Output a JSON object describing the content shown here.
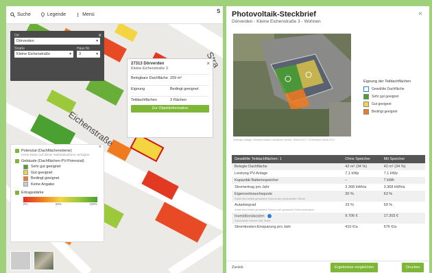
{
  "topbar": {
    "search_label": "Suche",
    "legend_label": "Legende",
    "menu_label": "Menü",
    "right_letter": "S"
  },
  "search_panel": {
    "ort_label": "Ort",
    "ort_value": "Dörverden",
    "strasse_label": "Straße",
    "strasse_value": "Kleine Eichenstraße",
    "hausnr_label": "Haus Nr.",
    "hausnr_value": "3"
  },
  "map": {
    "street_name": "Eichenstraße",
    "street_fragment": "Stra"
  },
  "popup": {
    "title": "27313 Dörverden",
    "subtitle": "Kleine Eichenstraße 3",
    "rows": [
      {
        "k": "Belegbare Dachfläche",
        "v": "209 m²"
      },
      {
        "k": "Eignung",
        "v": "Bedingt geeignet"
      },
      {
        "k": "Teildachflächen",
        "v": "3 Flächen"
      }
    ],
    "button_label": "Zur Objektinformation"
  },
  "legend": {
    "potential_label": "Potenzial (Dachflächenebene)",
    "potential_note": "Keine Daten auf dieser Maßstabsebene verfügbar",
    "roofs_label": "Gebäude (Dachflächen-PV-Potenzial)",
    "items": [
      {
        "label": "Sehr gut geeignet",
        "color": "#4aa030"
      },
      {
        "label": "Gut geeignet",
        "color": "#f2d540"
      },
      {
        "label": "Bedingt geeignet",
        "color": "#f07a20"
      },
      {
        "label": "Keine Angabe",
        "color": "#cccccc"
      }
    ],
    "yield_label": "Ertragsstärke",
    "grad_min": "0%",
    "grad_mid": "50%",
    "grad_max": "100%"
  },
  "panel": {
    "title": "Photovoltaik-Steckbrief",
    "subtitle": "Dörverden - Kleine Eichenstraße 3 - Wohnen",
    "photo_credit": "Datengrundlage: Geoinformation Landkreis Verden, Stand 2017 / Orthofotos Stand 2017",
    "roof_legend_title": "Eignung der Teildachflächen",
    "roof_legend": [
      {
        "label": "Gewählte Dachfläche",
        "color": "#ffffff",
        "border": "#2a7fd0"
      },
      {
        "label": "Sehr gut geeignet",
        "color": "#4aa030",
        "border": "#888888"
      },
      {
        "label": "Gut geeignet",
        "color": "#f2d540",
        "border": "#888888"
      },
      {
        "label": "Bedingt geeignet",
        "color": "#f07a20",
        "border": "#888888"
      }
    ],
    "table_header": [
      "Gewählte Teildachflächen: 1",
      "Ohne Speicher",
      "Mit Speicher"
    ],
    "table_rows": [
      {
        "label": "Belegte Dachfläche",
        "note": "",
        "a": "42 m² (34 %)",
        "b": "42 m² (34 %)"
      },
      {
        "label": "Leistung PV-Anlage",
        "note": "",
        "a": "7,1 kWp",
        "b": "7,1 kWp"
      },
      {
        "label": "Kapazität Batteriespeicher",
        "note": "",
        "a": "–",
        "b": "7 kWh"
      },
      {
        "label": "Stromertrag pro Jahr",
        "note": "",
        "a": "3.368 kWh/a",
        "b": "3.368 kWh/a"
      },
      {
        "label": "Eigenverbrauchsquote",
        "note": "Anteil des selbst genutzten Stroms am produzierten Strom",
        "a": "30 %",
        "b": "63 %"
      },
      {
        "label": "Autarkiegrad",
        "note": "Anteil des selbst genutzten Stroms am gesamten Stromverbrauch",
        "a": "33 %",
        "b": "69 %"
      },
      {
        "label": "Investitionskosten",
        "note": "Geschätzte Kosten inkl. Mwst.",
        "a": "9.706 €",
        "b": "17.303 €"
      },
      {
        "label": "Stromkosten-Einsparung pro Jahr",
        "note": "",
        "a": "410 €/a",
        "b": "676 €/a"
      }
    ],
    "back_label": "Zurück",
    "compare_label": "Ergebnisse vergleichen",
    "print_label": "Drucken"
  }
}
